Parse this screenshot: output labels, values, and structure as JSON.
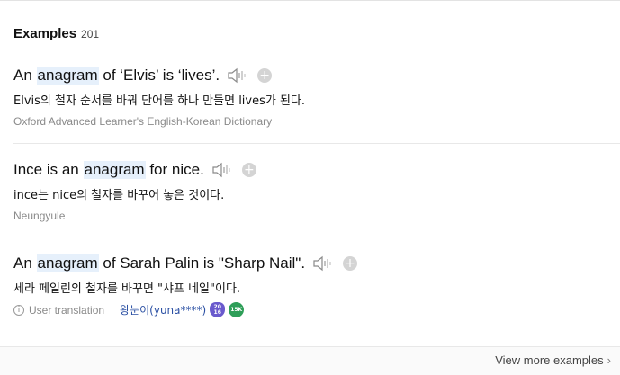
{
  "header": {
    "title": "Examples",
    "count": "201"
  },
  "examples": [
    {
      "pre": "An ",
      "highlight": "anagram",
      "post": " of ‘Elvis’ is ‘lives’.",
      "translation": "Elvis의 철자 순서를 바꿔 단어를 하나 만들면 lives가 된다.",
      "source": "Oxford Advanced Learner's English-Korean Dictionary"
    },
    {
      "pre": "Ince is an ",
      "highlight": "anagram",
      "post": " for nice.",
      "translation": "ince는 nice의 철자를 바꾸어 놓은 것이다.",
      "source": "Neungyule"
    },
    {
      "pre": "An ",
      "highlight": "anagram",
      "post": " of Sarah Palin is \"Sharp Nail\".",
      "translation": "세라 페일린의 철자를 바꾸면 \"샤프 네일\"이다.",
      "meta_label": "User translation",
      "user": "왕눈이(yuna****)",
      "badge_year": "20\n16",
      "badge_count": "15K"
    }
  ],
  "footer": {
    "more_label": "View more examples",
    "chevron": "›"
  },
  "icons": {
    "speaker": "speaker-icon",
    "add": "plus-icon",
    "info": "info-icon"
  },
  "colors": {
    "highlight": "#e6f0fb",
    "user_link": "#2a4fa3",
    "badge_year": "#6a5acd",
    "badge_count": "#2e9e58"
  }
}
